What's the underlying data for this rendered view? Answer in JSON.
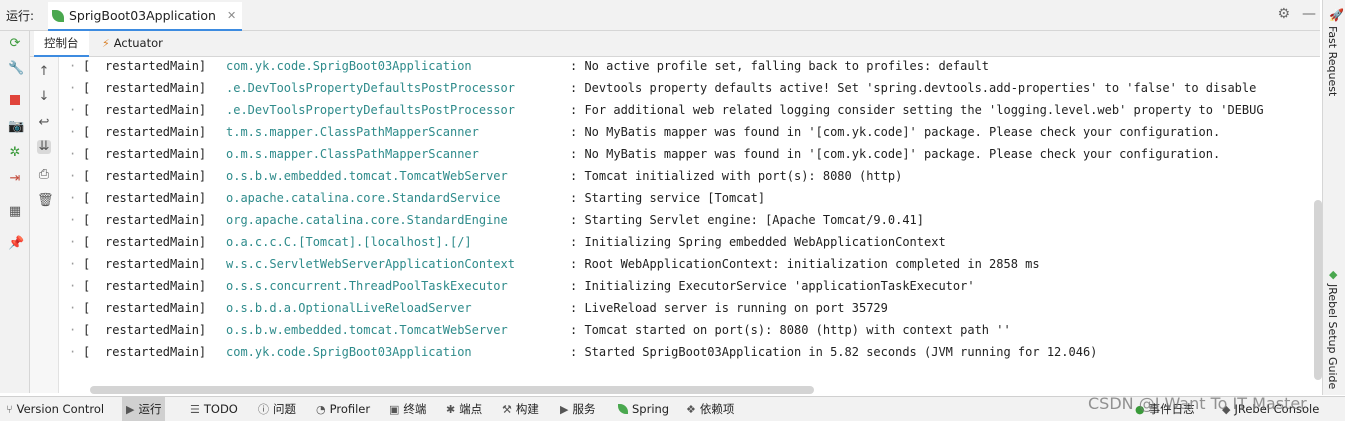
{
  "run_label": "运行:",
  "run_tab": {
    "label": "SprigBoot03Application",
    "close": "✕"
  },
  "subtabs": [
    {
      "label": "控制台"
    },
    {
      "label": "Actuator"
    }
  ],
  "console_lines": [
    {
      "thread": "restartedMain]",
      "logger": "com.yk.code.SprigBoot03Application",
      "msg": ": No active profile set, falling back to profiles: default"
    },
    {
      "thread": "restartedMain]",
      "logger": ".e.DevToolsPropertyDefaultsPostProcessor",
      "msg": ": Devtools property defaults active! Set 'spring.devtools.add-properties' to 'false' to disable"
    },
    {
      "thread": "restartedMain]",
      "logger": ".e.DevToolsPropertyDefaultsPostProcessor",
      "msg": ": For additional web related logging consider setting the 'logging.level.web' property to 'DEBUG"
    },
    {
      "thread": "restartedMain]",
      "logger": "t.m.s.mapper.ClassPathMapperScanner",
      "msg": ": No MyBatis mapper was found in '[com.yk.code]' package. Please check your configuration."
    },
    {
      "thread": "restartedMain]",
      "logger": "o.m.s.mapper.ClassPathMapperScanner",
      "msg": ": No MyBatis mapper was found in '[com.yk.code]' package. Please check your configuration."
    },
    {
      "thread": "restartedMain]",
      "logger": "o.s.b.w.embedded.tomcat.TomcatWebServer",
      "msg": ": Tomcat initialized with port(s): 8080 (http)"
    },
    {
      "thread": "restartedMain]",
      "logger": "o.apache.catalina.core.StandardService",
      "msg": ": Starting service [Tomcat]"
    },
    {
      "thread": "restartedMain]",
      "logger": "org.apache.catalina.core.StandardEngine",
      "msg": ": Starting Servlet engine: [Apache Tomcat/9.0.41]"
    },
    {
      "thread": "restartedMain]",
      "logger": "o.a.c.c.C.[Tomcat].[localhost].[/]",
      "msg": ": Initializing Spring embedded WebApplicationContext"
    },
    {
      "thread": "restartedMain]",
      "logger": "w.s.c.ServletWebServerApplicationContext",
      "msg": ": Root WebApplicationContext: initialization completed in 2858 ms"
    },
    {
      "thread": "restartedMain]",
      "logger": "o.s.s.concurrent.ThreadPoolTaskExecutor",
      "msg": ": Initializing ExecutorService 'applicationTaskExecutor'"
    },
    {
      "thread": "restartedMain]",
      "logger": "o.s.b.d.a.OptionalLiveReloadServer",
      "msg": ": LiveReload server is running on port 35729"
    },
    {
      "thread": "restartedMain]",
      "logger": "o.s.b.w.embedded.tomcat.TomcatWebServer",
      "msg": ": Tomcat started on port(s): 8080 (http) with context path ''"
    },
    {
      "thread": "restartedMain]",
      "logger": "com.yk.code.SprigBoot03Application",
      "msg": ": Started SprigBoot03Application in 5.82 seconds (JVM running for 12.046)"
    }
  ],
  "right_bar": {
    "top_label": "Fast Request",
    "bottom_label": "JRebel Setup Guide"
  },
  "statusbar": {
    "version_control": "Version Control",
    "run": "运行",
    "todo": "TODO",
    "problems": "问题",
    "profiler": "Profiler",
    "terminal": "终端",
    "breakpoints": "端点",
    "build": "构建",
    "services": "服务",
    "spring": "Spring",
    "dependencies": "依赖项",
    "event_log": "事件日志",
    "jrebel_console": "JRebel Console"
  },
  "watermark": "CSDN @I Want To IT Master",
  "colors": {
    "logger": "#2e8b8b",
    "accent": "#3d8be0",
    "stop_red": "#e0443a",
    "run_green": "#4aa84f"
  }
}
